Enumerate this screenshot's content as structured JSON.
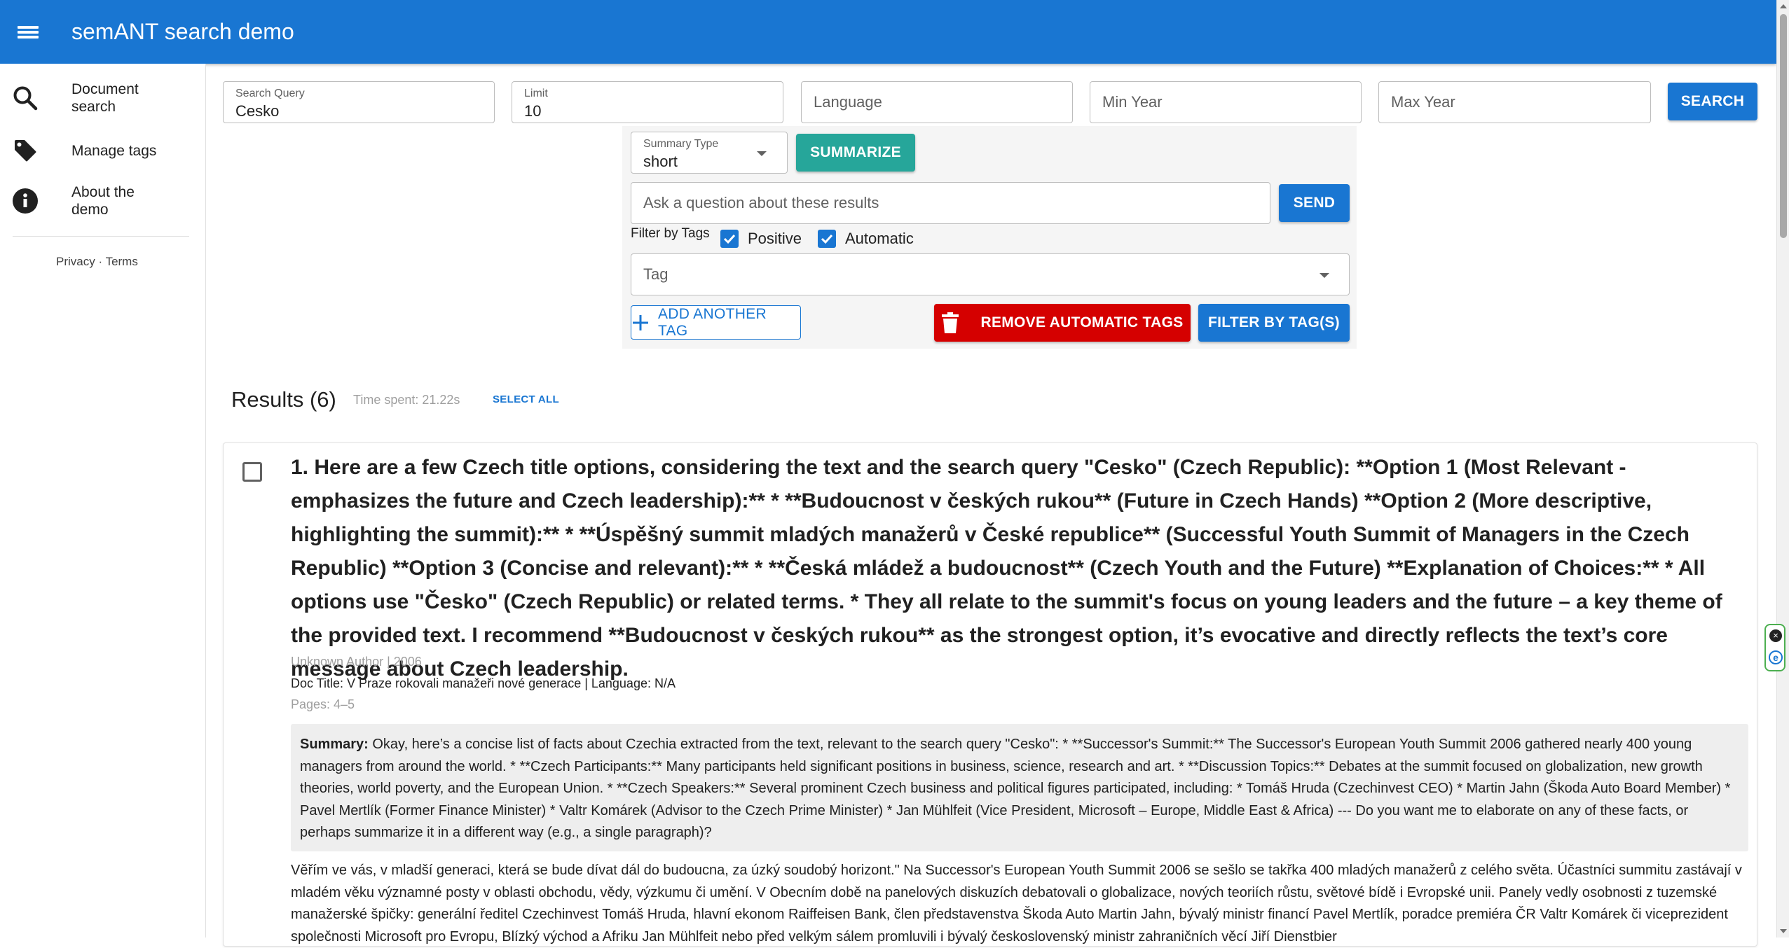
{
  "app": {
    "title": "semANT search demo"
  },
  "sidebar": {
    "items": [
      {
        "label": "Document\nsearch",
        "icon": "search-icon"
      },
      {
        "label": "Manage tags",
        "icon": "tag-icon"
      },
      {
        "label": "About the\ndemo",
        "icon": "info-icon"
      }
    ],
    "privacy": "Privacy",
    "separator": "·",
    "terms": "Terms"
  },
  "search": {
    "query_label": "Search Query",
    "query_value": "Cesko",
    "limit_label": "Limit",
    "limit_value": "10",
    "language_placeholder": "Language",
    "min_year_placeholder": "Min Year",
    "max_year_placeholder": "Max Year",
    "search_button": "SEARCH"
  },
  "panel": {
    "summary_type_label": "Summary Type",
    "summary_type_value": "short",
    "summarize_button": "SUMMARIZE",
    "question_placeholder": "Ask a question about these results",
    "send_button": "SEND",
    "filter_label": "Filter by Tags",
    "positive_label": "Positive",
    "positive_checked": true,
    "automatic_label": "Automatic",
    "automatic_checked": true,
    "tag_placeholder": "Tag",
    "add_tag_button": "ADD ANOTHER TAG",
    "remove_auto_button": "REMOVE AUTOMATIC TAGS",
    "filter_button": "FILTER BY TAG(S)"
  },
  "results": {
    "title": "Results (6)",
    "time_spent": "Time spent: 21.22s",
    "select_all": "SELECT ALL",
    "items": [
      {
        "title": "1. Here are a few Czech title options, considering the text and the search query \"Cesko\" (Czech Republic): **Option 1 (Most Relevant - emphasizes the future and Czech leadership):** * **Budoucnost v českých rukou** (Future in Czech Hands) **Option 2 (More descriptive, highlighting the summit):** * **Úspěšný summit mladých manažerů v České republice** (Successful Youth Summit of Managers in the Czech Republic) **Option 3 (Concise and relevant):** * **Česká mládež a budoucnost** (Czech Youth and the Future) **Explanation of Choices:** * All options use \"Česko\" (Czech Republic) or related terms. * They all relate to the summit's focus on young leaders and the future – a key theme of the provided text. I recommend **Budoucnost v českých rukou** as the strongest option, it’s evocative and directly reflects the text’s core message about Czech leadership.",
        "author_year": "Unknown Author | 2006",
        "doc_title": "Doc Title: V Praze rokovali manažeři nové generace | Language: N/A",
        "pages": "Pages: 4–5",
        "summary_label": "Summary:",
        "summary": " Okay, here’s a concise list of facts about Czechia extracted from the text, relevant to the search query \"Cesko\": * **Successor's Summit:** The Successor's European Youth Summit 2006 gathered nearly 400 young managers from around the world. * **Czech Participants:** Many participants held significant positions in business, science, research and art. * **Discussion Topics:** Debates at the summit focused on globalization, new growth theories, world poverty, and the European Union. * **Czech Speakers:** Several prominent Czech business and political figures participated, including: * Tomáš Hruda (Czechinvest CEO) * Martin Jahn (Škoda Auto Board Member) * Pavel Mertlík (Former Finance Minister) * Valtr Komárek (Advisor to the Czech Prime Minister) * Jan Mühlfeit (Vice President, Microsoft – Europe, Middle East & Africa) --- Do you want me to elaborate on any of these facts, or perhaps summarize it in a different way (e.g., a single paragraph)?",
        "text": "Věřím ve vás, v mladší generaci, která se bude dívat dál do budoucna, za úzký soudobý horizont.\" Na Successor's European Youth Summit 2006 se sešlo se takřka 400 mladých manažerů z celého světa. Účastníci summitu zastávají v mladém věku významné posty v oblasti obchodu, vědy, výzkumu či umění. V Obecním době na panelových diskuzích debatovali o globalizace, nových teoriích růstu, světové bídě i Evropské unii. Panely vedly osobnosti z tuzemské manažerské špičky: generální ředitel Czechinvest Tomáš Hruda, hlavní ekonom Raiffeisen Bank, člen představenstva Škoda Auto Martin Jahn, bývalý ministr financí Pavel Mertlík, poradce premiéra ČR Valtr Komárek či viceprezident společnosti Microsoft pro Evropu, Blízký východ a Afriku Jan Mühlfeit nebo před velkým sálem promluvili i bývalý československý ministr zahraničních věcí Jiří Dienstbier"
      }
    ]
  },
  "colors": {
    "primary": "#1976d2",
    "teal": "#26a69a",
    "danger": "#d50000"
  }
}
